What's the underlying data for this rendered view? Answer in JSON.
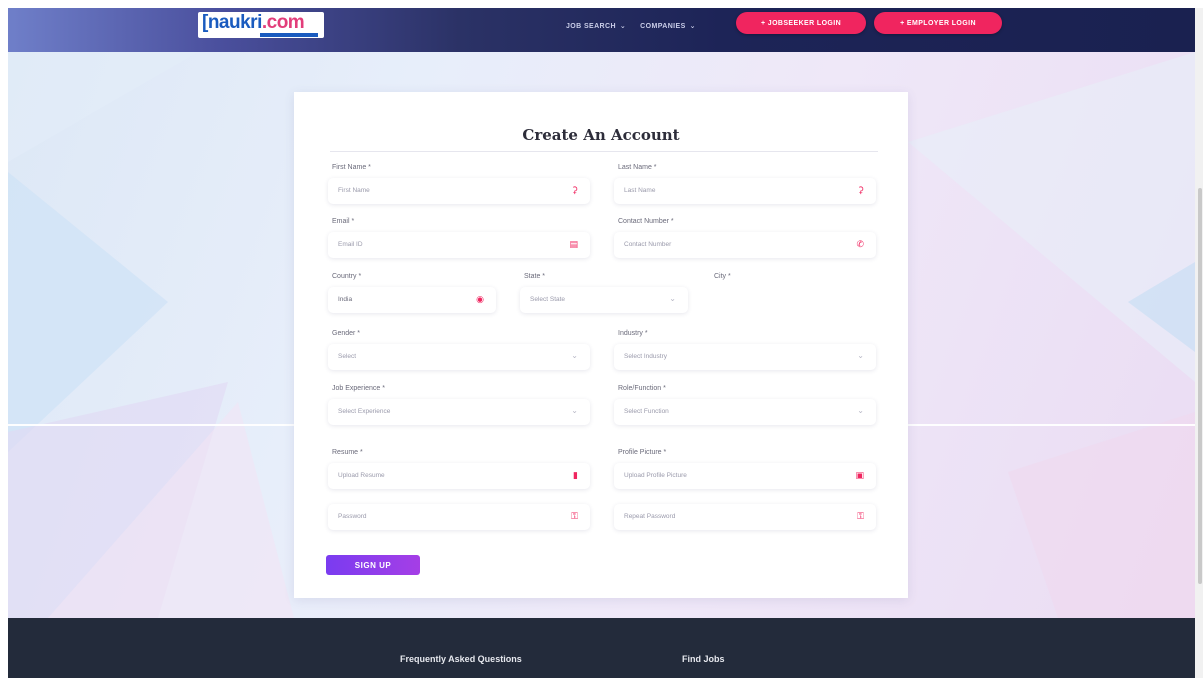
{
  "header": {
    "logo_text": "naukri",
    "logo_suffix": ".com",
    "nav": [
      {
        "label": "JOB SEARCH"
      },
      {
        "label": "COMPANIES"
      }
    ],
    "jobseeker_login": "+ JOBSEEKER LOGIN",
    "employer_login": "+ EMPLOYER LOGIN"
  },
  "form": {
    "title": "Create An Account",
    "first_name": {
      "label": "First Name *",
      "placeholder": "First Name",
      "icon": "user-icon"
    },
    "last_name": {
      "label": "Last Name *",
      "placeholder": "Last Name",
      "icon": "user-icon"
    },
    "email": {
      "label": "Email *",
      "placeholder": "Email ID",
      "icon": "calendar-icon"
    },
    "contact": {
      "label": "Contact Number *",
      "placeholder": "Contact Number",
      "icon": "phone-icon"
    },
    "country": {
      "label": "Country *",
      "value": "India",
      "icon": "location-icon"
    },
    "state": {
      "label": "State *",
      "placeholder": "Select State"
    },
    "city": {
      "label": "City *"
    },
    "gender": {
      "label": "Gender *",
      "placeholder": "Select"
    },
    "industry": {
      "label": "Industry *",
      "placeholder": "Select Industry"
    },
    "experience": {
      "label": "Job Experience *",
      "placeholder": "Select Experience"
    },
    "function": {
      "label": "Role/Function *",
      "placeholder": "Select Function"
    },
    "resume": {
      "label": "Resume *",
      "placeholder": "Upload Resume",
      "icon": "file-icon"
    },
    "picture": {
      "label": "Profile Picture *",
      "placeholder": "Upload Profile Picture",
      "icon": "image-icon"
    },
    "password": {
      "placeholder": "Password",
      "icon": "key-icon"
    },
    "repeat_password": {
      "placeholder": "Repeat Password",
      "icon": "key-icon"
    },
    "submit": "SIGN UP"
  },
  "footer": {
    "faq": "Frequently Asked Questions",
    "find_jobs": "Find Jobs"
  },
  "colors": {
    "accent": "#f0255f",
    "navy": "#1d2457",
    "signup": "#8b3ded",
    "footer": "#232b3b"
  }
}
